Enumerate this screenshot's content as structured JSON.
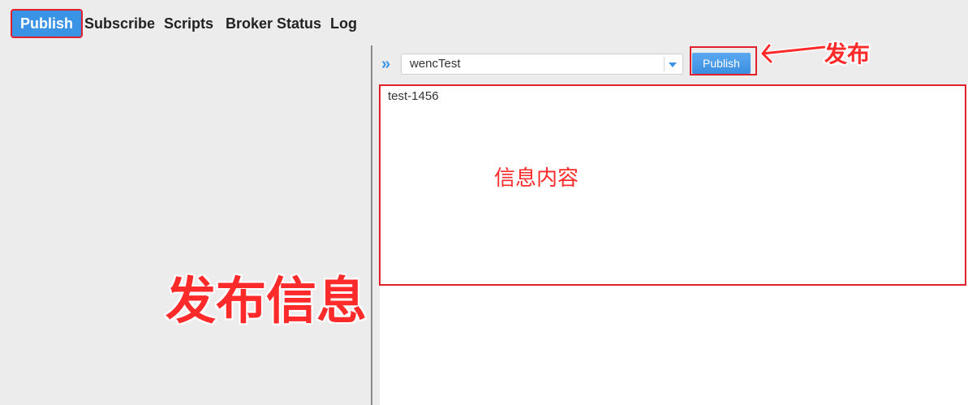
{
  "nav": {
    "items": [
      {
        "label": "Publish",
        "active": true
      },
      {
        "label": "Subscribe",
        "active": false
      },
      {
        "label": "Scripts",
        "active": false
      },
      {
        "label": "Broker Status",
        "active": false
      },
      {
        "label": "Log",
        "active": false
      }
    ]
  },
  "publish": {
    "topic_value": "wencTest",
    "button_label": "Publish",
    "message": "test-1456"
  },
  "annotations": {
    "publish_arrow_label": "发布",
    "message_content_label": "信息内容",
    "publish_info_label": "发布信息"
  },
  "colors": {
    "accent": "#3b93e6",
    "annotation_red": "#e0202a"
  },
  "icons": {
    "expand": "double-chevron-right-icon",
    "dropdown": "caret-down-icon"
  }
}
